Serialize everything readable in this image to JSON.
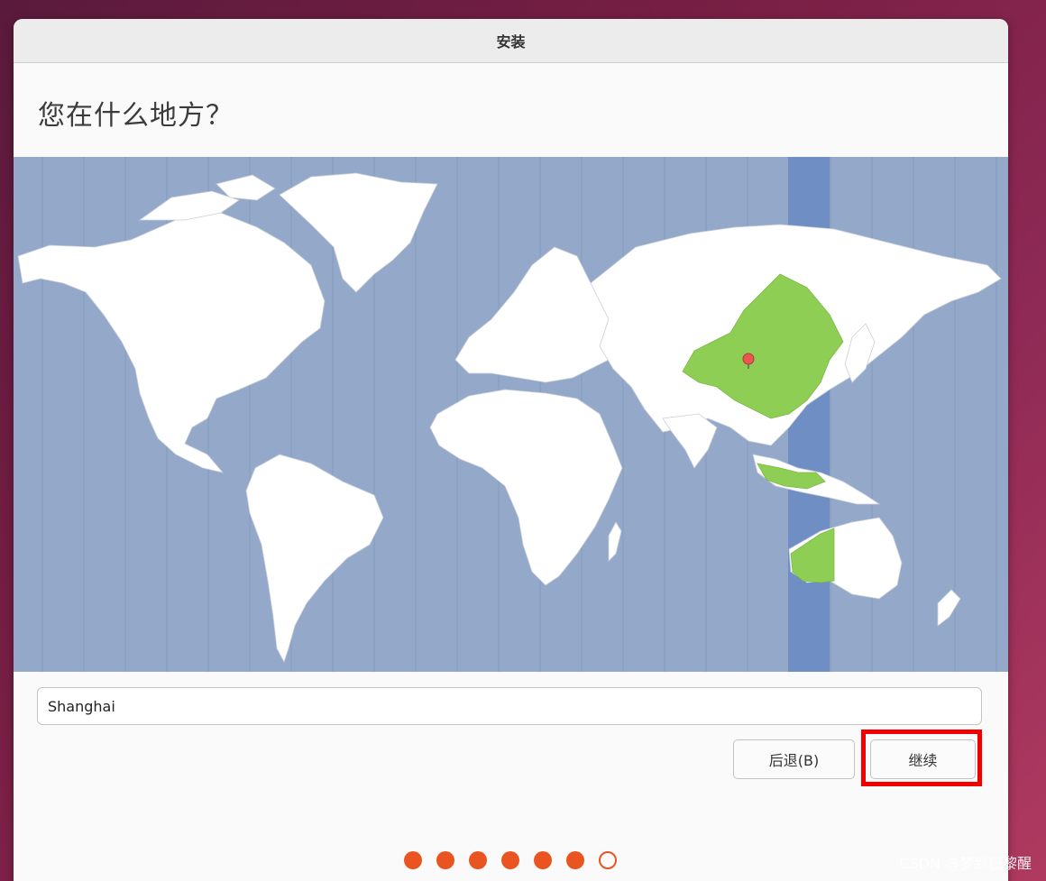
{
  "window": {
    "title": "安装"
  },
  "page": {
    "heading": "您在什么地方？"
  },
  "map": {
    "highlighted_timezone": "Asia/Shanghai",
    "colors": {
      "ocean": "#94a9c9",
      "land": "#ffffff",
      "highlight_region": "#8fce55",
      "highlight_band": "#6f8fc4",
      "pin": "#e8584f"
    }
  },
  "location": {
    "value": "Shanghai"
  },
  "buttons": {
    "back_label": "后退(B)",
    "continue_label": "继续"
  },
  "progress": {
    "total_steps": 7,
    "completed_steps": 6
  },
  "watermark": "CSDN @梦到巴黎醒"
}
